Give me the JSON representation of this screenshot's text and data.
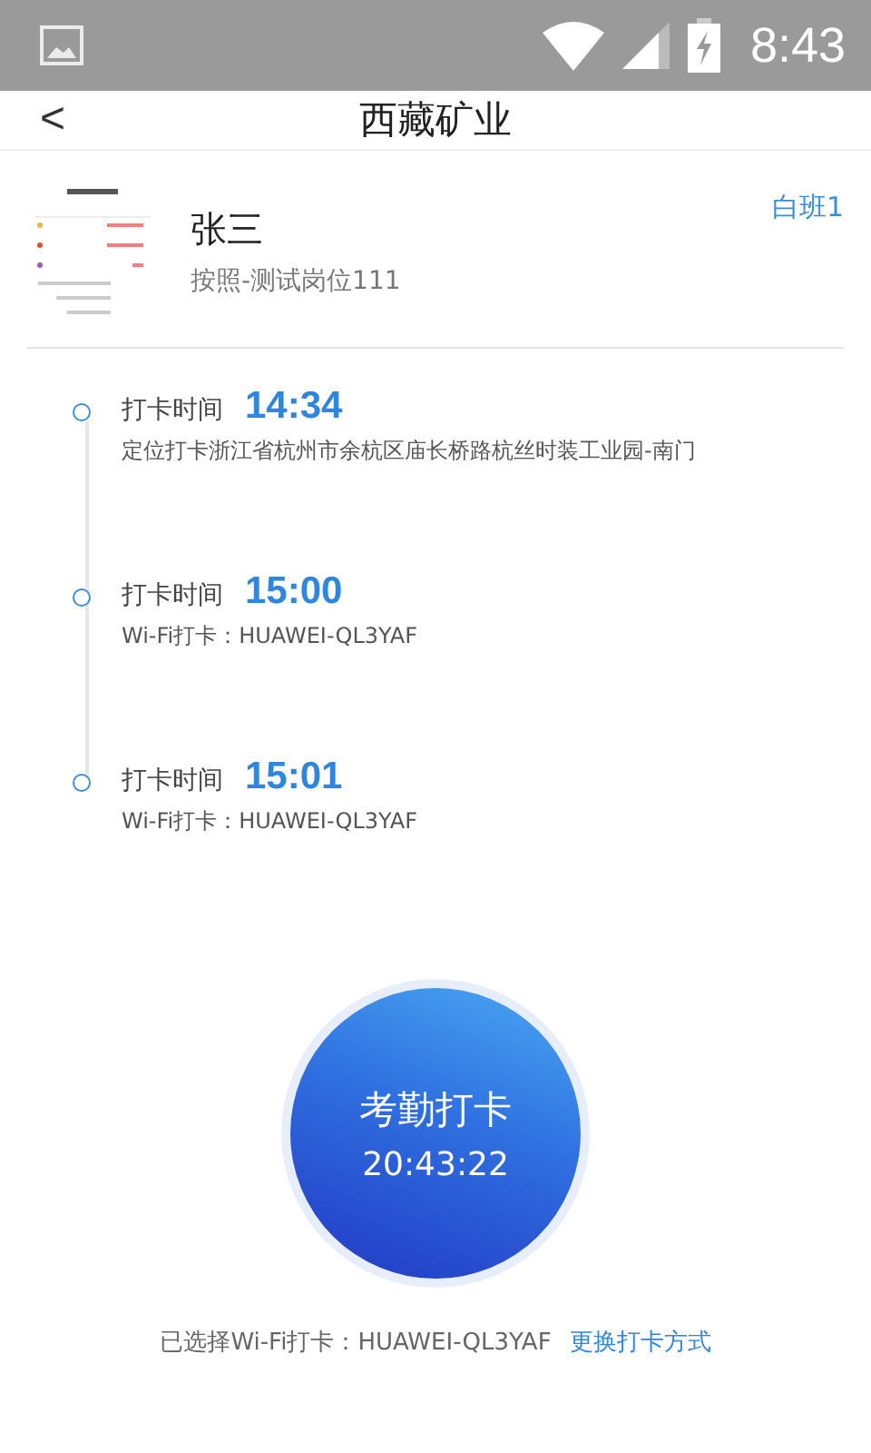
{
  "status_bar": {
    "time": "8:43"
  },
  "header": {
    "back": "<",
    "title": "西藏矿业"
  },
  "profile": {
    "name": "张三",
    "position": "按照-测试岗位111",
    "shift": "白班1"
  },
  "records": [
    {
      "label": "打卡时间",
      "time": "14:34",
      "detail": "定位打卡浙江省杭州市余杭区庙长桥路杭丝时装工业园-南门"
    },
    {
      "label": "打卡时间",
      "time": "15:00",
      "detail": "Wi-Fi打卡：HUAWEI-QL3YAF"
    },
    {
      "label": "打卡时间",
      "time": "15:01",
      "detail": "Wi-Fi打卡：HUAWEI-QL3YAF"
    }
  ],
  "clock_button": {
    "label": "考勤打卡",
    "time": "20:43:22"
  },
  "footer": {
    "selected": "已选择Wi-Fi打卡：HUAWEI-QL3YAF",
    "change_link": "更换打卡方式"
  }
}
